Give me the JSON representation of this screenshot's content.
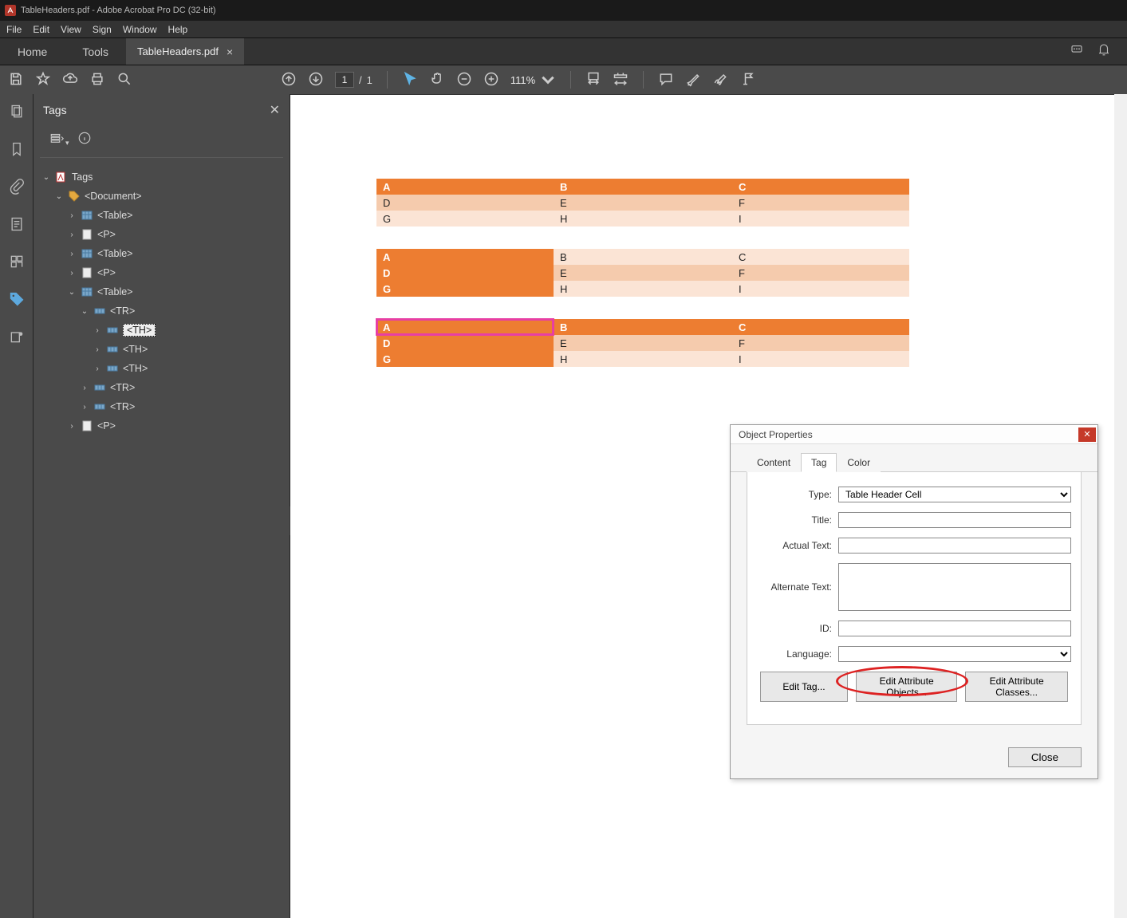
{
  "title": "TableHeaders.pdf - Adobe Acrobat Pro DC (32-bit)",
  "menu": [
    "File",
    "Edit",
    "View",
    "Sign",
    "Window",
    "Help"
  ],
  "tabs": {
    "home": "Home",
    "tools": "Tools",
    "doc": "TableHeaders.pdf"
  },
  "toolbar": {
    "page_current": "1",
    "page_total": "1",
    "page_sep": "/",
    "zoom": "111%"
  },
  "panel": {
    "title": "Tags",
    "tree": {
      "root": "Tags",
      "doc": "<Document>",
      "table": "<Table>",
      "p": "<P>",
      "tr": "<TR>",
      "th": "<TH>"
    }
  },
  "tables": [
    [
      [
        "A",
        "B",
        "C"
      ],
      [
        "D",
        "E",
        "F"
      ],
      [
        "G",
        "H",
        "I"
      ]
    ],
    [
      [
        "A",
        "B",
        "C"
      ],
      [
        "D",
        "E",
        "F"
      ],
      [
        "G",
        "H",
        "I"
      ]
    ],
    [
      [
        "A",
        "B",
        "C"
      ],
      [
        "D",
        "E",
        "F"
      ],
      [
        "G",
        "H",
        "I"
      ]
    ]
  ],
  "dialog": {
    "title": "Object Properties",
    "tab_content": "Content",
    "tab_tag": "Tag",
    "tab_color": "Color",
    "labels": {
      "type": "Type:",
      "title": "Title:",
      "actual": "Actual Text:",
      "alt": "Alternate Text:",
      "id": "ID:",
      "lang": "Language:"
    },
    "type_value": "Table Header Cell",
    "buttons": {
      "edit_tag": "Edit Tag...",
      "edit_attr_obj": "Edit Attribute Objects...",
      "edit_attr_cls": "Edit Attribute Classes...",
      "close": "Close"
    }
  }
}
